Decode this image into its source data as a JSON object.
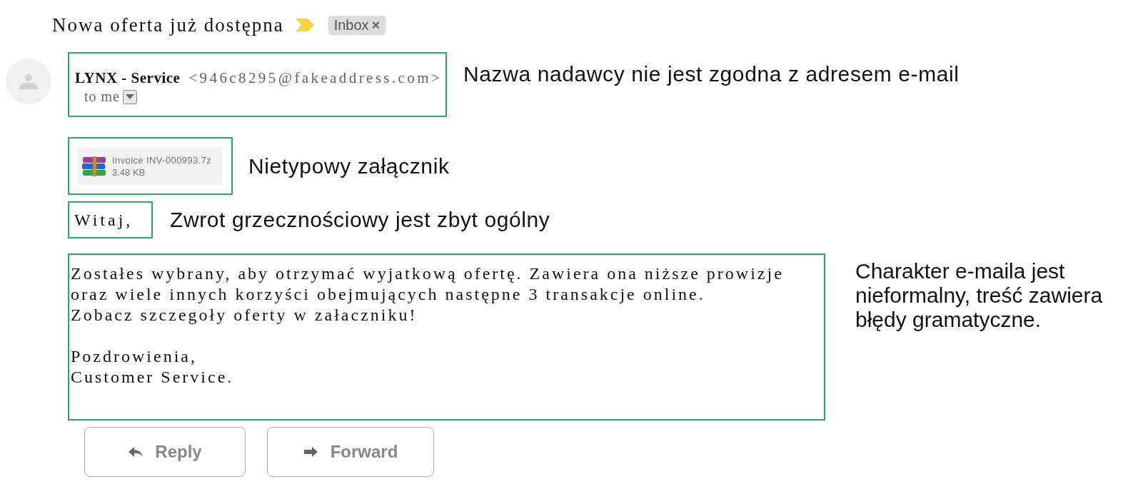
{
  "subject": "Nowa oferta już dostępna",
  "label": {
    "text": "Inbox",
    "close": "×"
  },
  "sender": {
    "name": "LYNX - Service",
    "email": "<946c8295@fakeaddress.com>",
    "recipient": "to me",
    "note": "Nazwa nadawcy nie jest zgodna z adresem e-mail"
  },
  "attachment": {
    "name": "Invoice INV-000993.7z",
    "size": "3.48 KB",
    "note": "Nietypowy załącznik"
  },
  "greeting": {
    "text": "Witaj,",
    "note": "Zwrot grzecznościowy jest zbyt ogólny"
  },
  "body": {
    "paragraphs": [
      [
        "Zostałes wybrany, aby otrzymać wyjatkową ofertę. Zawiera ona niższe prowizje",
        "oraz wiele innych korzyści obejmujących następne 3 transakcje online.",
        "Zobacz szczegoły oferty w załaczniku!"
      ],
      [
        "Pozdrowienia,",
        "Customer Service."
      ]
    ],
    "note": "Charakter e-maila jest nieformalny, treść zawiera błędy gramatyczne."
  },
  "buttons": [
    {
      "label": "Reply",
      "kind": "reply"
    },
    {
      "label": "Forward",
      "kind": "forward"
    }
  ]
}
